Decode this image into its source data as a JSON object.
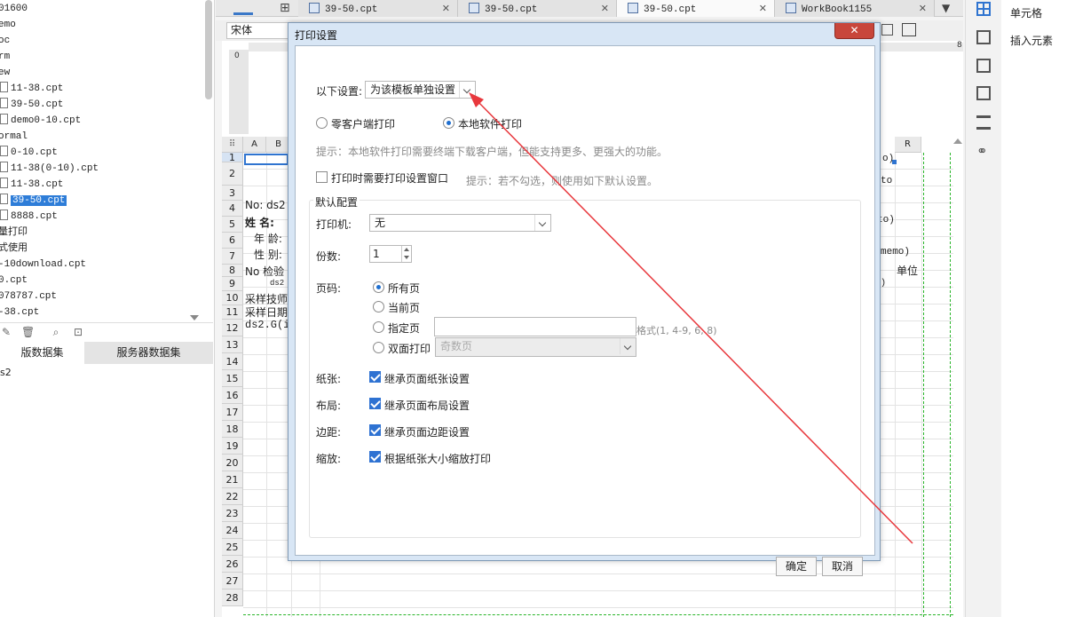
{
  "file_tree": {
    "items": [
      {
        "label": "01600",
        "doc": false,
        "indent": false
      },
      {
        "label": "emo",
        "doc": false,
        "indent": false
      },
      {
        "label": "oc",
        "doc": false,
        "indent": false
      },
      {
        "label": "rm",
        "doc": false,
        "indent": false
      },
      {
        "label": "ew",
        "doc": false,
        "indent": false
      },
      {
        "label": "11-38.cpt",
        "doc": true,
        "indent": true
      },
      {
        "label": "39-50.cpt",
        "doc": true,
        "indent": true
      },
      {
        "label": "demo0-10.cpt",
        "doc": true,
        "indent": true
      },
      {
        "label": "ormal",
        "doc": false,
        "indent": false
      },
      {
        "label": "0-10.cpt",
        "doc": true,
        "indent": true
      },
      {
        "label": "11-38(0-10).cpt",
        "doc": true,
        "indent": true
      },
      {
        "label": "11-38.cpt",
        "doc": true,
        "indent": true
      },
      {
        "label": "39-50.cpt",
        "doc": true,
        "indent": true,
        "selected": true
      },
      {
        "label": "8888.cpt",
        "doc": true,
        "indent": true
      },
      {
        "label": "量打印",
        "doc": false,
        "indent": false
      },
      {
        "label": "式使用",
        "doc": false,
        "indent": false
      },
      {
        "label": "-10download.cpt",
        "doc": false,
        "indent": false
      },
      {
        "label": "0.cpt",
        "doc": false,
        "indent": false
      },
      {
        "label": "078787.cpt",
        "doc": false,
        "indent": false
      },
      {
        "label": "-38.cpt",
        "doc": false,
        "indent": false
      }
    ]
  },
  "dataset_tabs": {
    "template_label": "版数据集",
    "server_label": "服务器数据集",
    "item": "s2"
  },
  "tabs": [
    {
      "label": "39-50.cpt",
      "active": false
    },
    {
      "label": "39-50.cpt",
      "active": false
    },
    {
      "label": "39-50.cpt",
      "active": true
    },
    {
      "label": "WorkBook1155",
      "active": false
    }
  ],
  "toolbar": {
    "font": "宋体"
  },
  "sheet": {
    "ruler_label": "0",
    "ruler_end": "8",
    "columns": [
      "A",
      "B",
      "R"
    ],
    "rows": [
      "1",
      "2",
      "3",
      "4",
      "5",
      "6",
      "7",
      "8",
      "9",
      "10",
      "11",
      "12",
      "13",
      "14",
      "15",
      "16",
      "17",
      "18",
      "19",
      "20",
      "21",
      "22",
      "23",
      "24",
      "25",
      "26",
      "27",
      "28"
    ],
    "cells": {
      "r3": "No: ds2",
      "r4": "姓 名:",
      "r5": "年 龄:",
      "r6": "性 别:",
      "r7": "No  检验",
      "r8": "ds2",
      "r9": "采样技师",
      "r10": "采样日期",
      "r11": "ds2.G(i",
      "right_r1": "o)",
      "right_r2": "to",
      "right_r4": "to)",
      "right_r6": "memo)",
      "right_r7": "单位",
      "right_r8": ")"
    }
  },
  "right_panel": {
    "cell_label": "单元格",
    "insert_label": "插入元素"
  },
  "dialog": {
    "title": "打印设置",
    "close": "✕",
    "setting_label": "以下设置:",
    "setting_value": "为该模板单独设置",
    "zero_client": "零客户端打印",
    "local_software": "本地软件打印",
    "hint1": "提示：本地软件打印需要终端下载客户端，但能支持更多、更强大的功能。",
    "show_dialog": "打印时需要打印设置窗口",
    "hint2": "提示：若不勾选，则使用如下默认设置。",
    "defaults_title": "默认配置",
    "printer_label": "打印机:",
    "printer_value": "无",
    "copies_label": "份数:",
    "copies_value": "1",
    "page_label": "页码:",
    "all_pages": "所有页",
    "current_page": "当前页",
    "specified_page": "指定页",
    "format_hint": "格式(1, 4-9, 6, 8)",
    "duplex": "双面打印",
    "duplex_value": "奇数页",
    "paper_label": "纸张:",
    "paper_value": "继承页面纸张设置",
    "layout_label": "布局:",
    "layout_value": "继承页面布局设置",
    "margin_label": "边距:",
    "margin_value": "继承页面边距设置",
    "scale_label": "缩放:",
    "scale_value": "根据纸张大小缩放打印",
    "ok": "确定",
    "cancel": "取消"
  },
  "colors": {
    "accent": "#2e72d2",
    "close_red": "#c8463b",
    "arrow_red": "#e8383d"
  }
}
